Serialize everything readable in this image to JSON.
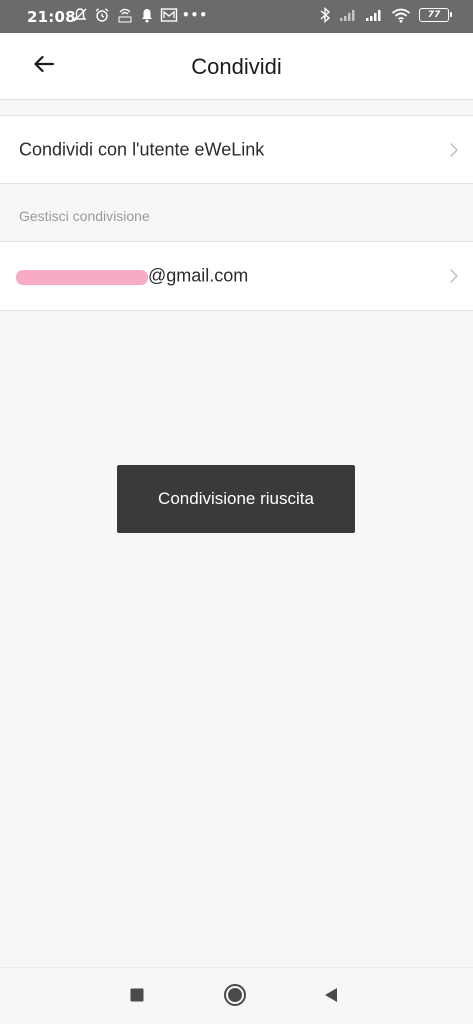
{
  "status_bar": {
    "time": "21:08",
    "battery_level": "77",
    "overflow": "•••",
    "left_icons": [
      "bell-off-icon",
      "alarm-icon",
      "hotspot-speed-icon",
      "notification-bell-icon",
      "message-icon"
    ],
    "right_icons": [
      "bluetooth-icon",
      "signal-icon",
      "signal-icon",
      "wifi-icon",
      "battery-icon"
    ]
  },
  "app_bar": {
    "title": "Condividi",
    "back_icon": "arrow-left-icon"
  },
  "share_row": {
    "label": "Condividi con l'utente eWeLink",
    "chevron_icon": "chevron-right-icon"
  },
  "section": {
    "header": "Gestisci condivisione"
  },
  "shared_user": {
    "email_suffix": "@gmail.com",
    "chevron_icon": "chevron-right-icon"
  },
  "toast": {
    "message": "Condivisione riuscita"
  },
  "nav_bar": {
    "icons": [
      "recents-square-icon",
      "home-circle-icon",
      "back-triangle-icon"
    ]
  },
  "colors": {
    "status_bar": "#6b6b6b",
    "background": "#f7f7f7",
    "surface": "#ffffff",
    "toast": "#3a3a3a",
    "redaction": "#f7a7c4"
  }
}
